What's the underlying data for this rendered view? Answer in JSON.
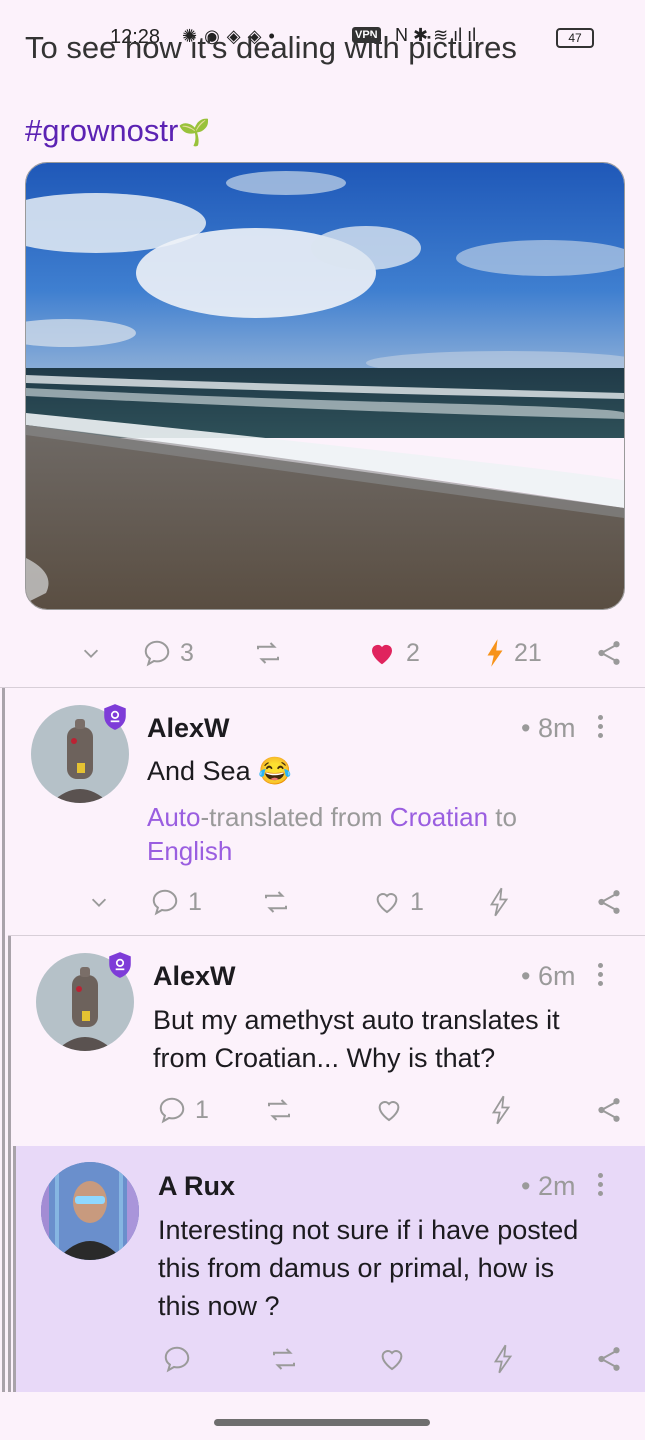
{
  "status_bar": {
    "time": "12:28",
    "vpn": "VPN",
    "battery": "47"
  },
  "post": {
    "text": "To see how it's dealing with pictures",
    "hashtag": "#grownostr",
    "image_alt": "beach with waves",
    "actions": {
      "replies": "3",
      "likes": "2",
      "zaps": "21"
    }
  },
  "replies": [
    {
      "name": "AlexW",
      "time": "• 8m",
      "content": "And Sea 😂",
      "translation": {
        "auto": "Auto",
        "middle": "-translated from ",
        "from_lang": "Croatian",
        "to": " to ",
        "to_lang": "English"
      },
      "actions": {
        "replies": "1",
        "likes": "1"
      }
    },
    {
      "name": "AlexW",
      "time": "• 6m",
      "content_line1": "But my amethyst auto translates it",
      "content_line2": "from Croatian... Why is that?",
      "actions": {
        "replies": "1"
      }
    },
    {
      "name": "A Rux",
      "time": "• 2m",
      "content_line1": "Interesting not sure if i have posted",
      "content_line2": "this from damus or primal, how is",
      "content_line3": "this now ?"
    }
  ],
  "colors": {
    "background": "#fcf2fb",
    "highlight": "#e8d9f8",
    "hashtag": "#5b22b3",
    "link": "#9a5ee0",
    "heart": "#e0245e",
    "zap": "#f7931a",
    "icon_gray": "#9a9a9a"
  }
}
